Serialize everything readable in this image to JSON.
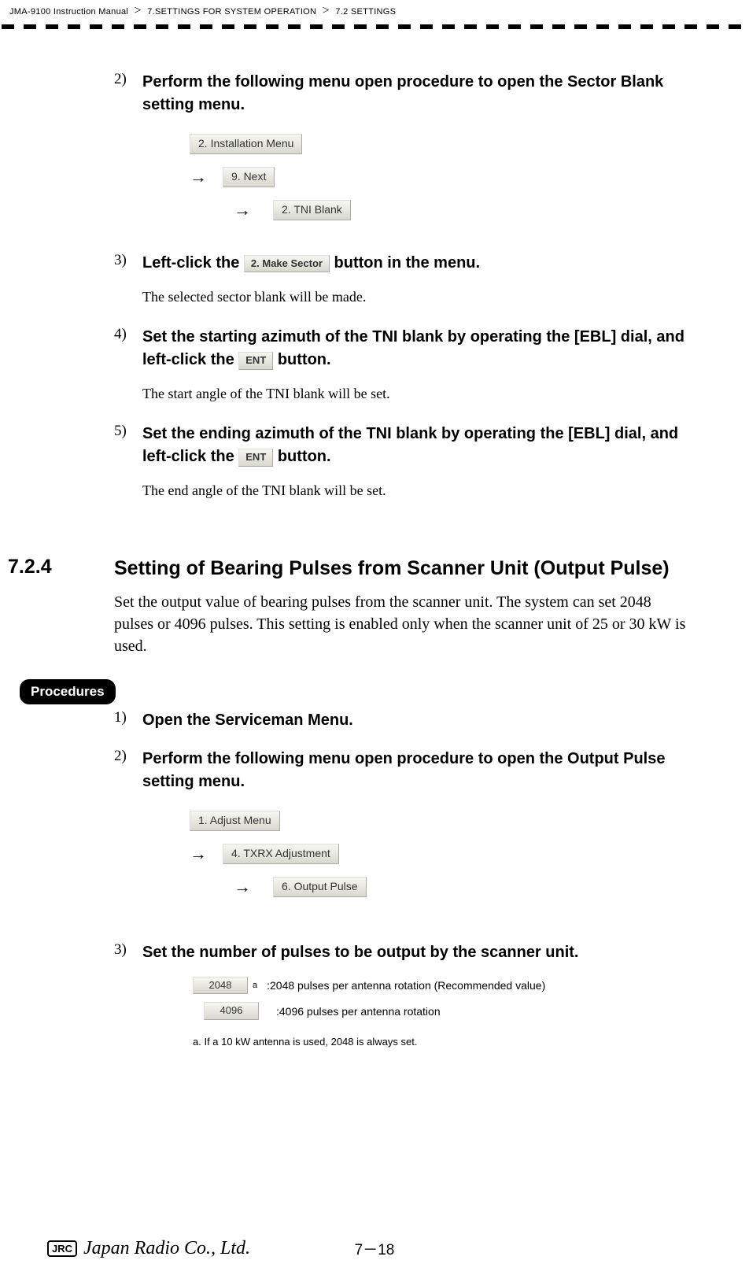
{
  "breadcrumb": {
    "a": "JMA-9100 Instruction Manual",
    "b": "7.SETTINGS FOR SYSTEM OPERATION",
    "c": "7.2  SETTINGS"
  },
  "steps_a": {
    "s2": {
      "num": "2)",
      "title": "Perform the following menu open procedure to open the Sector Blank setting menu.",
      "menu": {
        "b1": "2. Installation Menu",
        "b2": "9. Next",
        "b3": "2. TNI Blank"
      }
    },
    "s3": {
      "num": "3)",
      "title_pre": "Left-click the ",
      "btn": "2. Make Sector",
      "title_post": " button in the menu.",
      "body": "The selected sector blank will be made."
    },
    "s4": {
      "num": "4)",
      "title_pre": "Set the starting azimuth of the TNI blank by operating the [EBL] dial, and left-click the ",
      "btn": "ENT",
      "title_post": " button.",
      "body": "The start angle of the TNI blank will be set."
    },
    "s5": {
      "num": "5)",
      "title_pre": "Set the ending azimuth of the TNI blank by operating the [EBL] dial, and left-click the ",
      "btn": "ENT",
      "title_post": " button.",
      "body": "The end angle of the TNI blank will be set."
    }
  },
  "section": {
    "num": "7.2.4",
    "title": "Setting of Bearing Pulses from Scanner Unit (Output Pulse)",
    "para": "Set the output value of bearing pulses from the scanner unit. The system can set 2048 pulses or 4096 pulses. This setting is enabled only when the scanner unit of 25 or 30 kW is used."
  },
  "procedures_label": "Procedures",
  "steps_b": {
    "s1": {
      "num": "1)",
      "title": "Open the Serviceman Menu."
    },
    "s2": {
      "num": "2)",
      "title": "Perform the following menu open procedure to open the Output Pulse setting menu.",
      "menu": {
        "b1": "1. Adjust Menu",
        "b2": "4. TXRX Adjustment",
        "b3": "6. Output Pulse"
      }
    },
    "s3": {
      "num": "3)",
      "title": "Set the number of pulses to be output by the scanner unit.",
      "options": {
        "o1": {
          "btn": "2048",
          "sup": "a",
          "desc": ":2048 pulses per antenna rotation (Recommended value)"
        },
        "o2": {
          "btn": "4096",
          "desc": ":4096 pulses per antenna rotation"
        }
      },
      "footnote": "a.  If a 10 kW antenna is used,  2048  is always set."
    }
  },
  "footer": {
    "jrc": "JRC",
    "company": "Japan Radio Co., Ltd.",
    "page": "7－18"
  },
  "glyphs": {
    "arrow": "→"
  }
}
